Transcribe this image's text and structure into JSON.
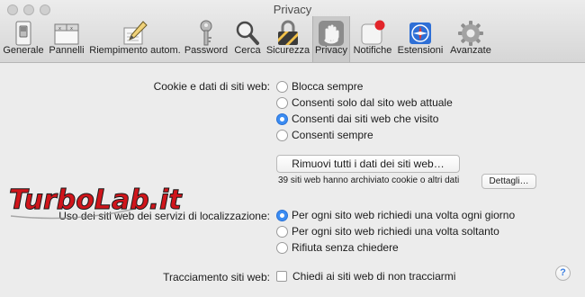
{
  "window": {
    "title": "Privacy"
  },
  "toolbar": {
    "items": [
      {
        "label": "Generale",
        "icon": "switch-icon"
      },
      {
        "label": "Pannelli",
        "icon": "tabs-icon"
      },
      {
        "label": "Riempimento autom.",
        "icon": "pencil-icon"
      },
      {
        "label": "Password",
        "icon": "key-icon"
      },
      {
        "label": "Cerca",
        "icon": "magnifier-icon"
      },
      {
        "label": "Sicurezza",
        "icon": "padlock-icon"
      },
      {
        "label": "Privacy",
        "icon": "hand-icon",
        "active": true
      },
      {
        "label": "Notifiche",
        "icon": "notification-icon"
      },
      {
        "label": "Estensioni",
        "icon": "puzzle-icon"
      },
      {
        "label": "Avanzate",
        "icon": "gear-icon"
      }
    ]
  },
  "cookies": {
    "label": "Cookie e dati di siti web:",
    "options": [
      {
        "label": "Blocca sempre",
        "selected": false
      },
      {
        "label": "Consenti solo dal sito web attuale",
        "selected": false
      },
      {
        "label": "Consenti dai siti web che visito",
        "selected": true
      },
      {
        "label": "Consenti sempre",
        "selected": false
      }
    ],
    "remove_button": "Rimuovi tutti i dati dei siti web…",
    "stored_info": "39 siti web hanno archiviato cookie o altri dati",
    "details_button": "Dettagli…"
  },
  "location": {
    "label": "Uso dei siti web dei servizi di localizzazione:",
    "options": [
      {
        "label": "Per ogni sito web richiedi una volta ogni giorno",
        "selected": true
      },
      {
        "label": "Per ogni sito web richiedi una volta soltanto",
        "selected": false
      },
      {
        "label": "Rifiuta senza chiedere",
        "selected": false
      }
    ]
  },
  "tracking": {
    "label": "Tracciamento siti web:",
    "checkbox_label": "Chiedi ai siti web di non tracciarmi",
    "checked": false
  },
  "help_button": "?",
  "watermark": {
    "text": "TurboLab.it"
  },
  "colors": {
    "accent": "#3b8cf2",
    "watermark_red": "#d0151b"
  }
}
